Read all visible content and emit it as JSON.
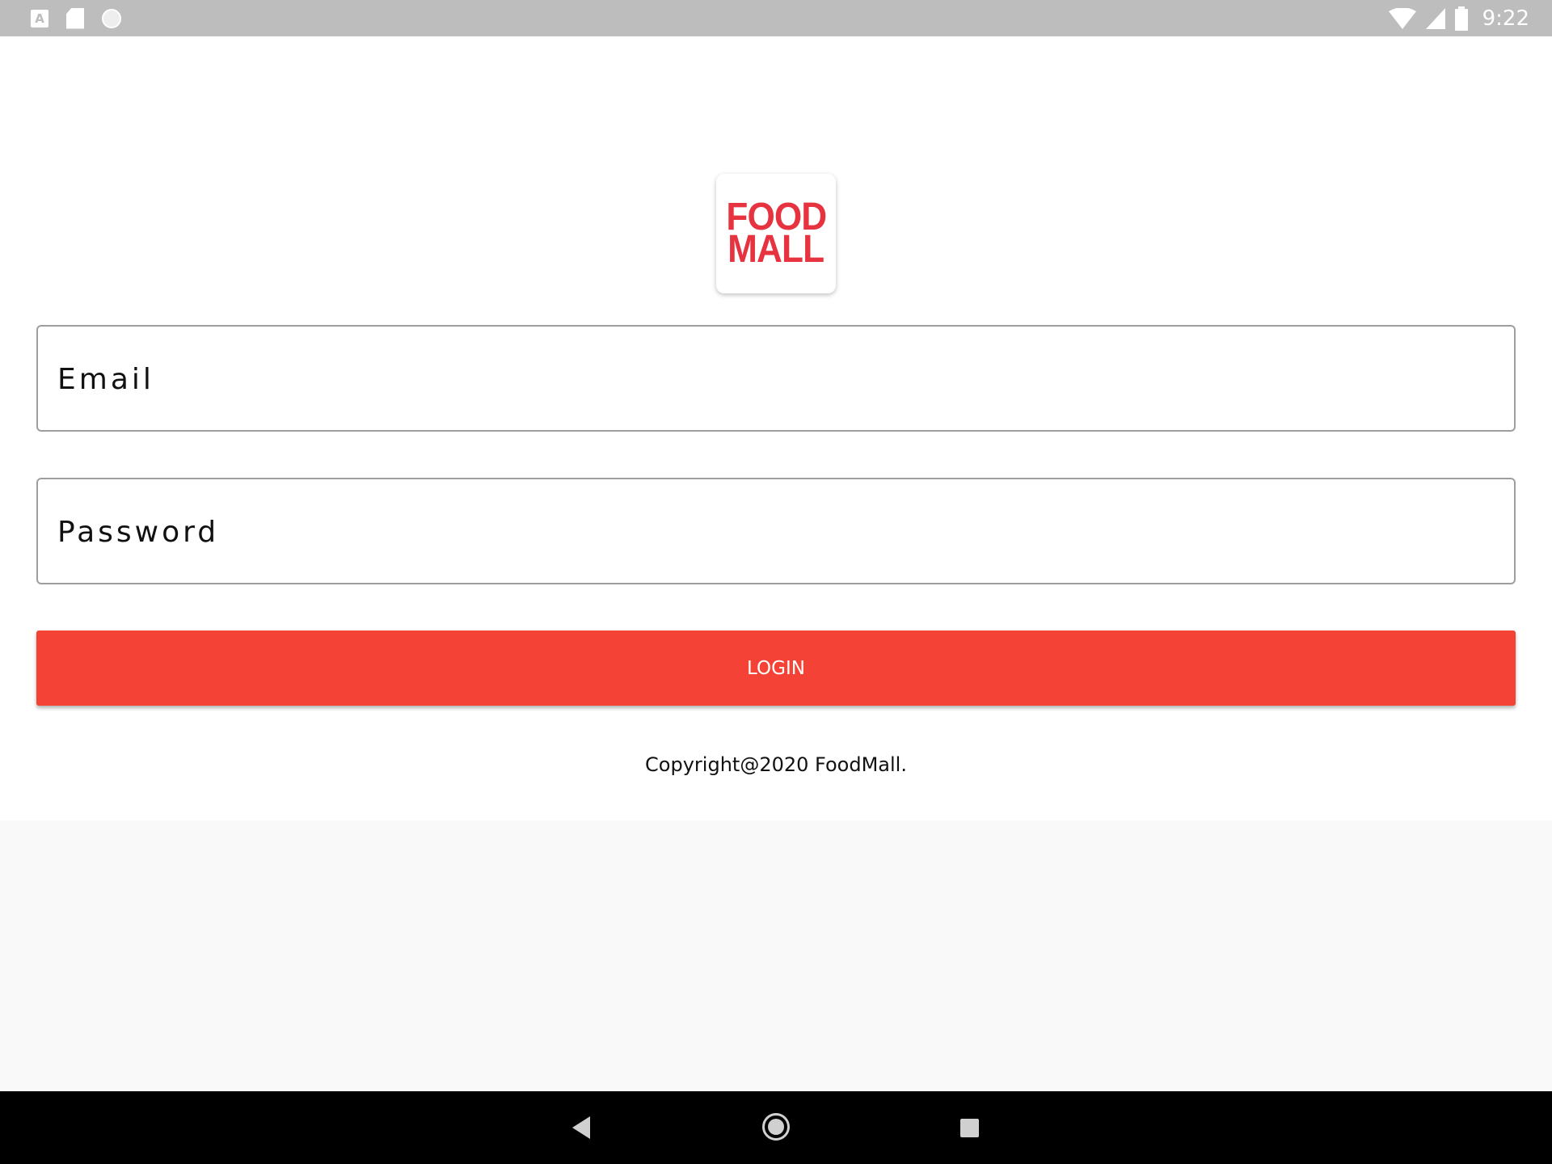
{
  "status_bar": {
    "time": "9:22",
    "left_icons": [
      "text-a-icon",
      "sd-card-icon",
      "circle-icon"
    ],
    "right_icons": [
      "wifi-icon",
      "signal-icon",
      "battery-icon"
    ]
  },
  "logo": {
    "line1": "FOOD",
    "line2": "MALL",
    "color": "#e6333f"
  },
  "form": {
    "email_placeholder": "Email",
    "password_placeholder": "Password",
    "login_label": "LOGIN",
    "button_color": "#f44336"
  },
  "footer": {
    "copyright": "Copyright@2020 FoodMall."
  },
  "nav_bar": {
    "icons": [
      "back-icon",
      "home-icon",
      "recents-icon"
    ]
  }
}
